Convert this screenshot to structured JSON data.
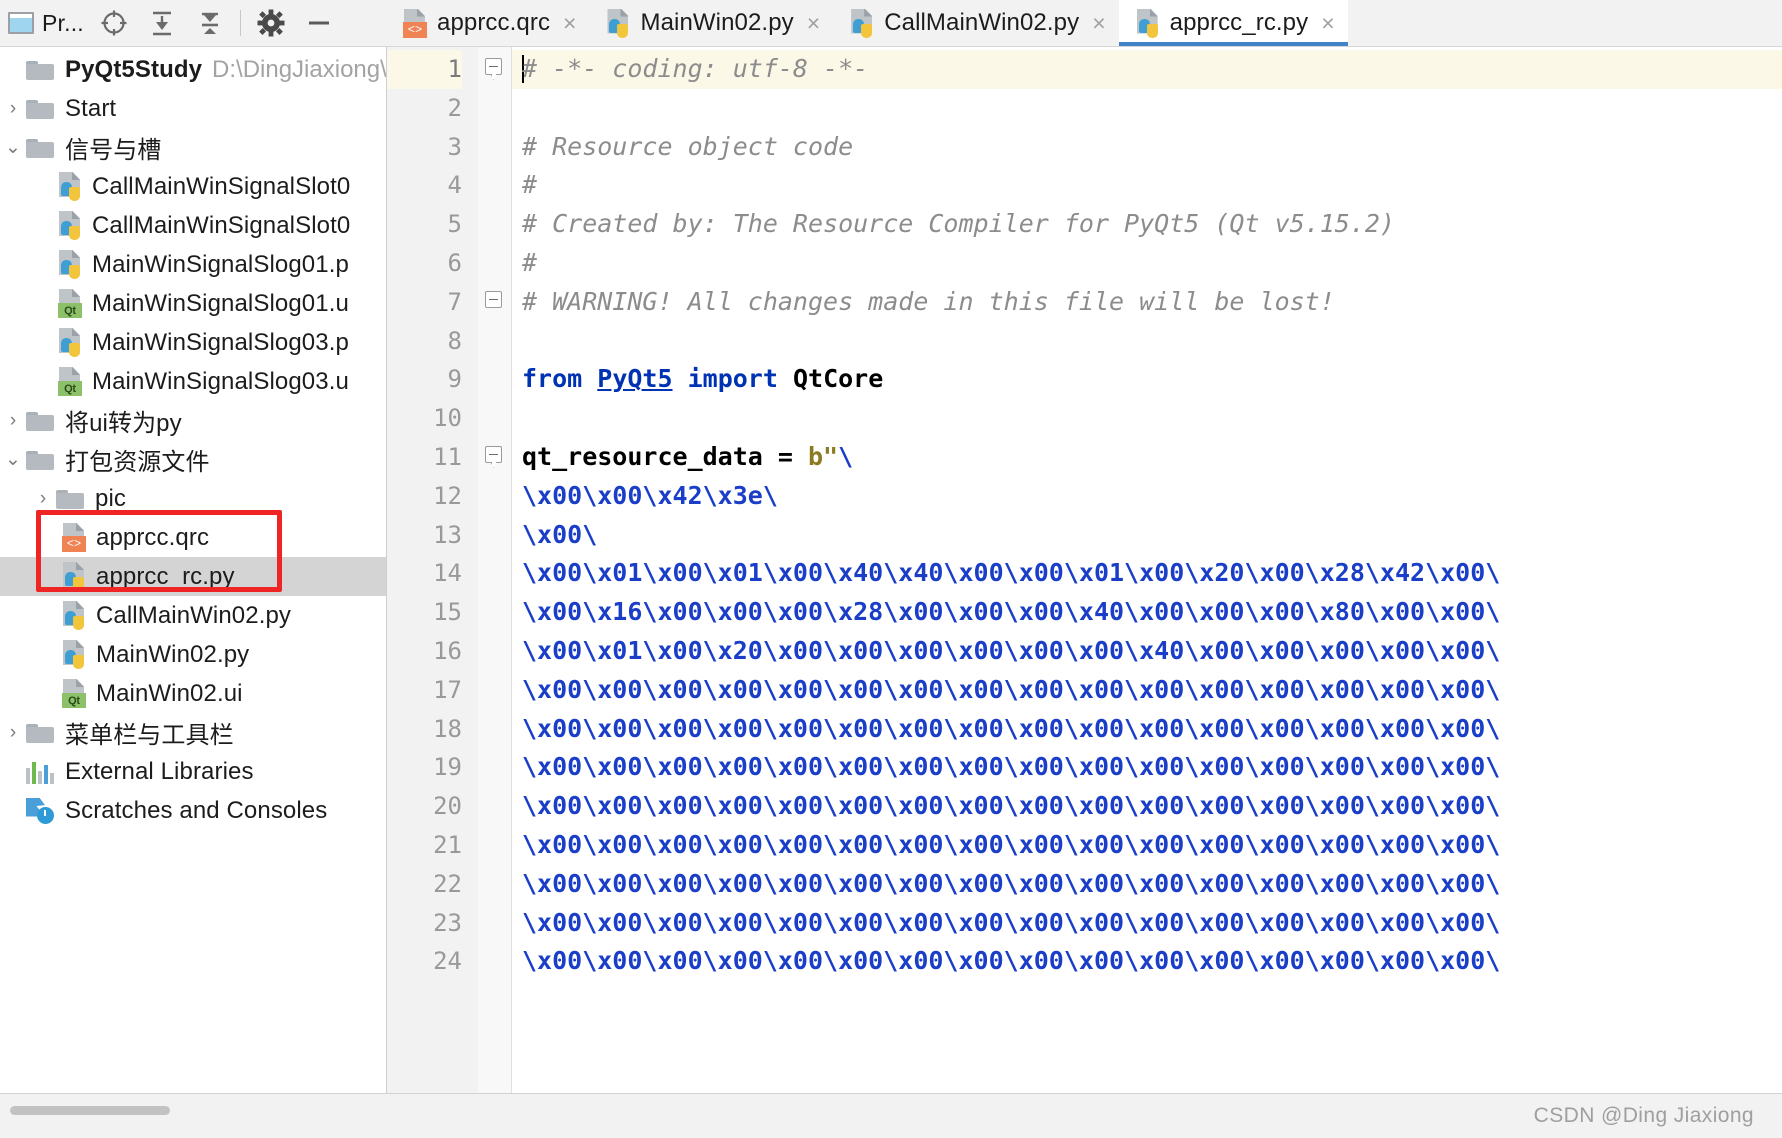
{
  "window": {
    "app": "PyCharm",
    "watermark": "CSDN @Ding Jiaxiong"
  },
  "project_toolbar": {
    "title": "Pr...",
    "icons": [
      {
        "name": "project-window-icon",
        "glyph": "window"
      },
      {
        "name": "locate-file-icon",
        "glyph": "crosshair"
      },
      {
        "name": "expand-all-icon",
        "glyph": "expand"
      },
      {
        "name": "collapse-all-icon",
        "glyph": "collapse"
      },
      {
        "name": "settings-gear-icon",
        "glyph": "gear"
      },
      {
        "name": "hide-panel-icon",
        "glyph": "minus"
      }
    ]
  },
  "tabs": [
    {
      "label": "apprcc.qrc",
      "icon": "qrc-file-icon",
      "active": false,
      "close": "×"
    },
    {
      "label": "MainWin02.py",
      "icon": "python-file-icon",
      "active": false,
      "close": "×"
    },
    {
      "label": "CallMainWin02.py",
      "icon": "python-file-icon",
      "active": false,
      "close": "×"
    },
    {
      "label": "apprcc_rc.py",
      "icon": "python-file-icon",
      "active": true,
      "close": "×"
    }
  ],
  "sidebar": {
    "root": {
      "label": "PyQt5Study",
      "path": "D:\\DingJiaxiong\\",
      "arrow": "⌄"
    },
    "items": [
      {
        "label": "Start",
        "kind": "folder",
        "indent": 1,
        "arrow": "›",
        "selected": false
      },
      {
        "label": "信号与槽",
        "kind": "folder",
        "indent": 1,
        "arrow": "⌄",
        "selected": false
      },
      {
        "label": "CallMainWinSignalSlot0",
        "kind": "py",
        "indent": 2,
        "arrow": "",
        "selected": false
      },
      {
        "label": "CallMainWinSignalSlot0",
        "kind": "py",
        "indent": 2,
        "arrow": "",
        "selected": false
      },
      {
        "label": "MainWinSignalSlog01.p",
        "kind": "py",
        "indent": 2,
        "arrow": "",
        "selected": false
      },
      {
        "label": "MainWinSignalSlog01.u",
        "kind": "ui",
        "indent": 2,
        "arrow": "",
        "selected": false
      },
      {
        "label": "MainWinSignalSlog03.p",
        "kind": "py",
        "indent": 2,
        "arrow": "",
        "selected": false
      },
      {
        "label": "MainWinSignalSlog03.u",
        "kind": "ui",
        "indent": 2,
        "arrow": "",
        "selected": false
      },
      {
        "label": "将ui转为py",
        "kind": "folder",
        "indent": 1,
        "arrow": "›",
        "selected": false
      },
      {
        "label": "打包资源文件",
        "kind": "folder",
        "indent": 1,
        "arrow": "⌄",
        "selected": false
      },
      {
        "label": "pic",
        "kind": "folder",
        "indent": 2,
        "arrow": "›",
        "selected": false
      },
      {
        "label": "apprcc.qrc",
        "kind": "qrc",
        "indent": 3,
        "arrow": "",
        "selected": false
      },
      {
        "label": "apprcc_rc.py",
        "kind": "py",
        "indent": 3,
        "arrow": "",
        "selected": true
      },
      {
        "label": "CallMainWin02.py",
        "kind": "py",
        "indent": 3,
        "arrow": "",
        "selected": false
      },
      {
        "label": "MainWin02.py",
        "kind": "py",
        "indent": 3,
        "arrow": "",
        "selected": false
      },
      {
        "label": "MainWin02.ui",
        "kind": "ui",
        "indent": 3,
        "arrow": "",
        "selected": false
      },
      {
        "label": "菜单栏与工具栏",
        "kind": "folder",
        "indent": 1,
        "arrow": "›",
        "selected": false
      },
      {
        "label": "External Libraries",
        "kind": "libs",
        "indent": 0,
        "arrow": "›",
        "selected": false
      },
      {
        "label": "Scratches and Consoles",
        "kind": "scratches",
        "indent": 0,
        "arrow": "",
        "selected": false
      }
    ],
    "qt_badge": "Qt",
    "qrc_badge": "<>"
  },
  "editor": {
    "file": "apprcc_rc.py",
    "current_line": 1,
    "line_numbers": [
      1,
      2,
      3,
      4,
      5,
      6,
      7,
      8,
      9,
      10,
      11,
      12,
      13,
      14,
      15,
      16,
      17,
      18,
      19,
      20,
      21,
      22,
      23,
      24
    ],
    "fold_markers": [
      1,
      7,
      11
    ],
    "lines": [
      {
        "n": 1,
        "type": "comment",
        "text": "# -*- coding: utf-8 -*-"
      },
      {
        "n": 2,
        "type": "blank",
        "text": ""
      },
      {
        "n": 3,
        "type": "comment",
        "text": "# Resource object code"
      },
      {
        "n": 4,
        "type": "comment",
        "text": "#"
      },
      {
        "n": 5,
        "type": "comment",
        "text": "# Created by: The Resource Compiler for PyQt5 (Qt v5.15.2)"
      },
      {
        "n": 6,
        "type": "comment",
        "text": "#"
      },
      {
        "n": 7,
        "type": "comment",
        "text": "# WARNING! All changes made in this file will be lost!"
      },
      {
        "n": 8,
        "type": "blank",
        "text": ""
      },
      {
        "n": 9,
        "type": "import",
        "text": "from PyQt5 import QtCore",
        "parts": [
          {
            "t": "from ",
            "c": "kw"
          },
          {
            "t": "PyQt5",
            "c": "link"
          },
          {
            "t": " ",
            "c": "plain"
          },
          {
            "t": "import",
            "c": "kw"
          },
          {
            "t": " ",
            "c": "plain"
          },
          {
            "t": "QtCore",
            "c": "bold"
          }
        ]
      },
      {
        "n": 10,
        "type": "blank",
        "text": ""
      },
      {
        "n": 11,
        "type": "assign",
        "text": "qt_resource_data = b\"\\",
        "parts": [
          {
            "t": "qt_resource_data ",
            "c": "bold"
          },
          {
            "t": "= ",
            "c": "bold"
          },
          {
            "t": "b\"",
            "c": "prefix"
          },
          {
            "t": "\\",
            "c": "str"
          }
        ]
      },
      {
        "n": 12,
        "type": "str",
        "text": "\\x00\\x00\\x42\\x3e\\"
      },
      {
        "n": 13,
        "type": "str",
        "text": "\\x00\\"
      },
      {
        "n": 14,
        "type": "str",
        "text": "\\x00\\x01\\x00\\x01\\x00\\x40\\x40\\x00\\x00\\x01\\x00\\x20\\x00\\x28\\x42\\x00\\"
      },
      {
        "n": 15,
        "type": "str",
        "text": "\\x00\\x16\\x00\\x00\\x00\\x28\\x00\\x00\\x00\\x40\\x00\\x00\\x00\\x80\\x00\\x00\\"
      },
      {
        "n": 16,
        "type": "str",
        "text": "\\x00\\x01\\x00\\x20\\x00\\x00\\x00\\x00\\x00\\x00\\x40\\x00\\x00\\x00\\x00\\x00\\"
      },
      {
        "n": 17,
        "type": "str",
        "text": "\\x00\\x00\\x00\\x00\\x00\\x00\\x00\\x00\\x00\\x00\\x00\\x00\\x00\\x00\\x00\\x00\\"
      },
      {
        "n": 18,
        "type": "str",
        "text": "\\x00\\x00\\x00\\x00\\x00\\x00\\x00\\x00\\x00\\x00\\x00\\x00\\x00\\x00\\x00\\x00\\"
      },
      {
        "n": 19,
        "type": "str",
        "text": "\\x00\\x00\\x00\\x00\\x00\\x00\\x00\\x00\\x00\\x00\\x00\\x00\\x00\\x00\\x00\\x00\\"
      },
      {
        "n": 20,
        "type": "str",
        "text": "\\x00\\x00\\x00\\x00\\x00\\x00\\x00\\x00\\x00\\x00\\x00\\x00\\x00\\x00\\x00\\x00\\"
      },
      {
        "n": 21,
        "type": "str",
        "text": "\\x00\\x00\\x00\\x00\\x00\\x00\\x00\\x00\\x00\\x00\\x00\\x00\\x00\\x00\\x00\\x00\\"
      },
      {
        "n": 22,
        "type": "str",
        "text": "\\x00\\x00\\x00\\x00\\x00\\x00\\x00\\x00\\x00\\x00\\x00\\x00\\x00\\x00\\x00\\x00\\"
      },
      {
        "n": 23,
        "type": "str",
        "text": "\\x00\\x00\\x00\\x00\\x00\\x00\\x00\\x00\\x00\\x00\\x00\\x00\\x00\\x00\\x00\\x00\\"
      },
      {
        "n": 24,
        "type": "str",
        "text": "\\x00\\x00\\x00\\x00\\x00\\x00\\x00\\x00\\x00\\x00\\x00\\x00\\x00\\x00\\x00\\x00\\"
      }
    ]
  },
  "colors": {
    "accent": "#4083c9",
    "highlight_box": "#ef2525",
    "comment": "#8c8c8c",
    "keyword": "#0033b3",
    "string": "#1a3ec8",
    "selection": "#d4d4d4",
    "current_line": "#fbf8e8"
  }
}
